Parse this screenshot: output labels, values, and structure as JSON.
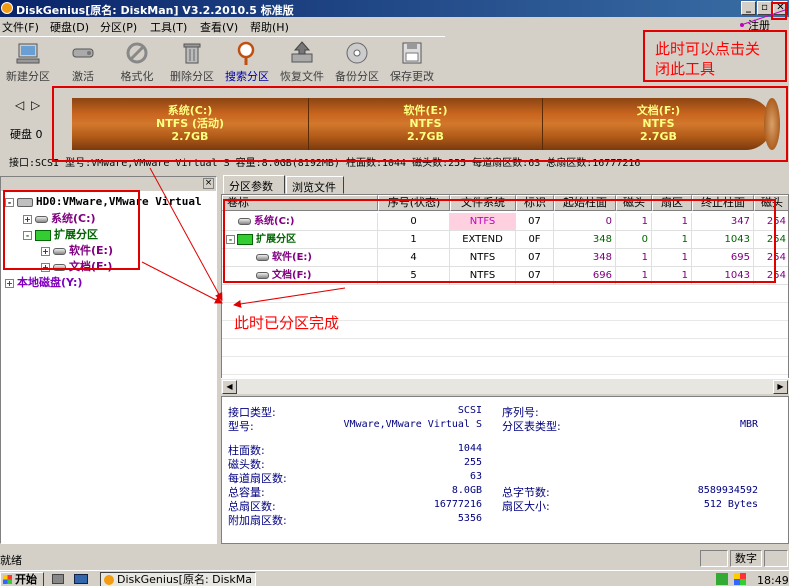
{
  "window": {
    "title": "DiskGenius[原名: DiskMan] V3.2.2010.5 标准版",
    "register_label": "注册"
  },
  "menu": [
    {
      "label": "文件(F)"
    },
    {
      "label": "硬盘(D)"
    },
    {
      "label": "分区(P)"
    },
    {
      "label": "工具(T)"
    },
    {
      "label": "查看(V)"
    },
    {
      "label": "帮助(H)"
    }
  ],
  "toolbar": [
    {
      "label": "新建分区",
      "icon": "new-partition-icon"
    },
    {
      "label": "激活",
      "icon": "activate-icon"
    },
    {
      "label": "格式化",
      "icon": "format-icon"
    },
    {
      "label": "删除分区",
      "icon": "delete-partition-icon"
    },
    {
      "label": "搜索分区",
      "icon": "search-partition-icon"
    },
    {
      "label": "恢复文件",
      "icon": "recover-files-icon"
    },
    {
      "label": "备份分区",
      "icon": "backup-partition-icon"
    },
    {
      "label": "保存更改",
      "icon": "save-changes-icon"
    }
  ],
  "disk_bar": {
    "disk_label": "硬盘 0",
    "segments": [
      {
        "line1": "系统(C:)",
        "line2": "NTFS (活动)",
        "line3": "2.7GB"
      },
      {
        "line1": "软件(E:)",
        "line2": "NTFS",
        "line3": "2.7GB"
      },
      {
        "line1": "文档(F:)",
        "line2": "NTFS",
        "line3": "2.7GB"
      }
    ],
    "info": "接口:SCSI  型号:VMware,VMware Virtual S  容量:8.0GB(8192MB)  柱面数:1044  磁头数:255  每道扇区数:63  总扇区数:16777216"
  },
  "tree": {
    "nodes": [
      {
        "label": "HD0:VMware,VMware Virtual",
        "expander": "-"
      },
      {
        "label": "系统(C:)",
        "expander": "+"
      },
      {
        "label": "扩展分区",
        "expander": "-"
      },
      {
        "label": "软件(E:)",
        "expander": "+"
      },
      {
        "label": "文档(F:)",
        "expander": "+"
      },
      {
        "label": "本地磁盘(Y:)",
        "expander": "+"
      }
    ],
    "close_label": "×"
  },
  "tabs": [
    {
      "label": "分区参数"
    },
    {
      "label": "浏览文件"
    }
  ],
  "table": {
    "headers": [
      "卷标",
      "序号(状态)",
      "文件系统",
      "标识",
      "起始柱面",
      "磁头",
      "扇区",
      "终止柱面",
      "磁头"
    ],
    "rows": [
      {
        "name": "系统(C:)",
        "expander": "",
        "cells": [
          "0",
          "NTFS",
          "07",
          "0",
          "1",
          "1",
          "347",
          "254"
        ]
      },
      {
        "name": "扩展分区",
        "expander": "-",
        "cells": [
          "1",
          "EXTEND",
          "0F",
          "348",
          "0",
          "1",
          "1043",
          "254"
        ]
      },
      {
        "name": "软件(E:)",
        "expander": "",
        "cells": [
          "4",
          "NTFS",
          "07",
          "348",
          "1",
          "1",
          "695",
          "254"
        ]
      },
      {
        "name": "文档(F:)",
        "expander": "",
        "cells": [
          "5",
          "NTFS",
          "07",
          "696",
          "1",
          "1",
          "1043",
          "254"
        ]
      }
    ]
  },
  "details": {
    "left": [
      {
        "label": "接口类型:",
        "value": "SCSI"
      },
      {
        "label": "型号:",
        "value": "VMware,VMware Virtual S"
      },
      {
        "label": "柱面数:",
        "value": "1044"
      },
      {
        "label": "磁头数:",
        "value": "255"
      },
      {
        "label": "每道扇区数:",
        "value": "63"
      },
      {
        "label": "总容量:",
        "value": "8.0GB"
      },
      {
        "label": "总扇区数:",
        "value": "16777216"
      },
      {
        "label": "附加扇区数:",
        "value": "5356"
      }
    ],
    "right": [
      {
        "label": "序列号:",
        "value": ""
      },
      {
        "label": "分区表类型:",
        "value": "MBR"
      },
      {
        "label": "总字节数:",
        "value": "8589934592"
      },
      {
        "label": "扇区大小:",
        "value": "512 Bytes"
      }
    ]
  },
  "statusbar": {
    "text": "就绪",
    "numlock": "数字"
  },
  "taskbar": {
    "start": "开始",
    "task": "DiskGenius[原名: DiskMa",
    "clock": "18:49"
  },
  "annotations": {
    "close_hint_line1": "此时可以点击关",
    "close_hint_line2": "闭此工具",
    "done_hint": "此时已分区完成"
  },
  "colors": {
    "title_bar": "#0a246a",
    "partition_bar": "#c8641e",
    "annotation": "#e00000",
    "primary_text": "#000080",
    "extended_text": "#006400"
  }
}
